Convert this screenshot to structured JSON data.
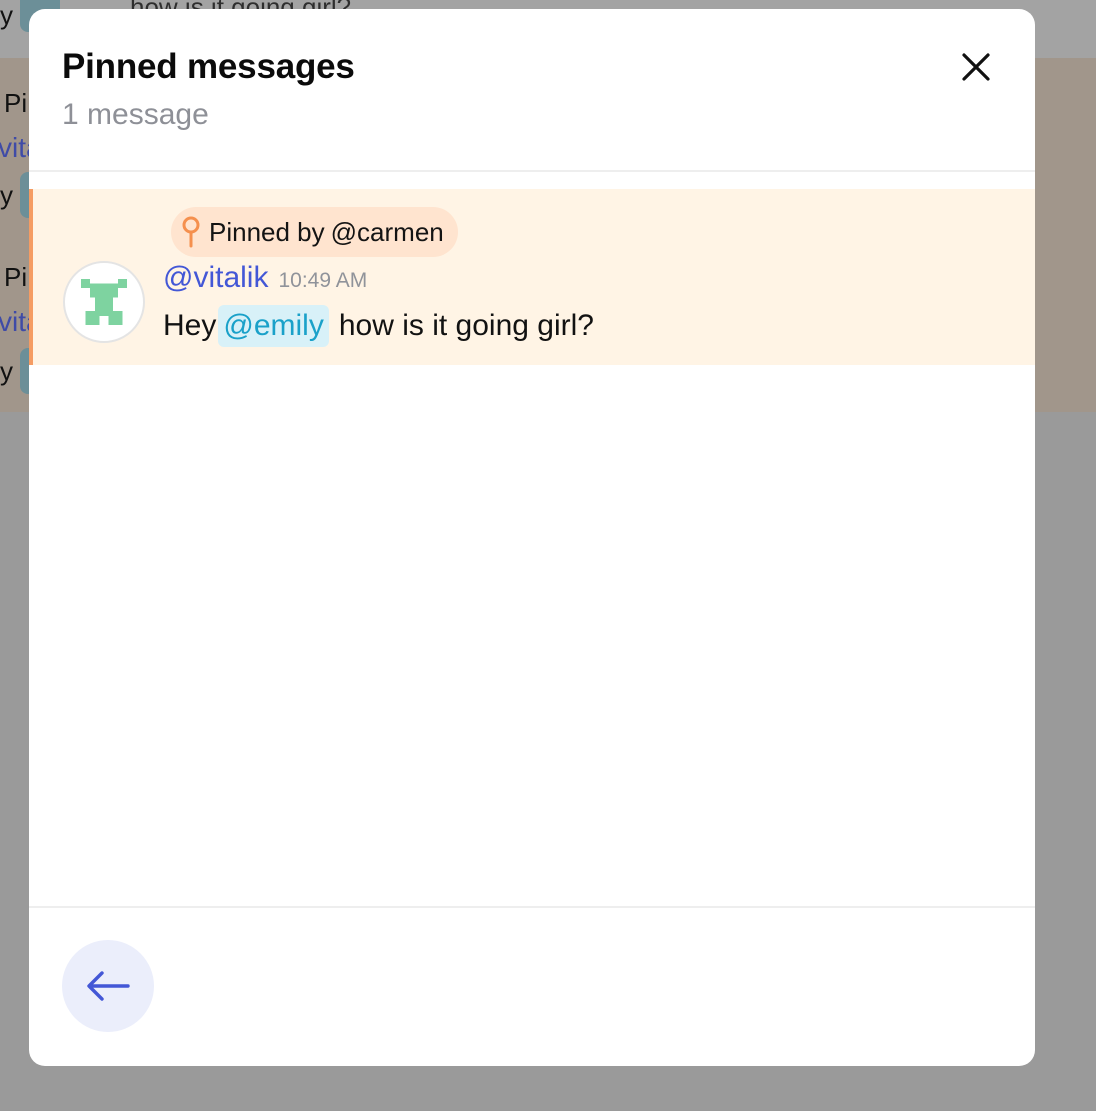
{
  "background_chat": {
    "rows": [
      {
        "prefix": "y",
        "text": " how is it going girl?"
      },
      {
        "label": "Pi",
        "handle": "vita",
        "prefix": "y"
      },
      {
        "label": "Pi",
        "handle": "vita",
        "prefix": "y"
      }
    ]
  },
  "modal": {
    "title": "Pinned messages",
    "subtitle": "1 message",
    "close_icon": "close-icon",
    "back_icon": "arrow-left-icon"
  },
  "pinned_messages": [
    {
      "pinned_by_label": "Pinned by",
      "pinned_by_user": "@carmen",
      "author": "@vitalik",
      "time": "10:49 AM",
      "text_before": "Hey",
      "mention": "@emily",
      "text_after": "how is it going girl?",
      "pin_icon": "map-pin-icon",
      "avatar_icon": "pixel-avatar-icon"
    }
  ],
  "colors": {
    "accent_link": "#4357d6",
    "mention_text": "#1aa1c9",
    "mention_bg": "#d8f1f8",
    "pinned_bg": "#fff4e5",
    "pinned_accent": "#f59c63",
    "avatar_green": "#7ed3a0"
  }
}
